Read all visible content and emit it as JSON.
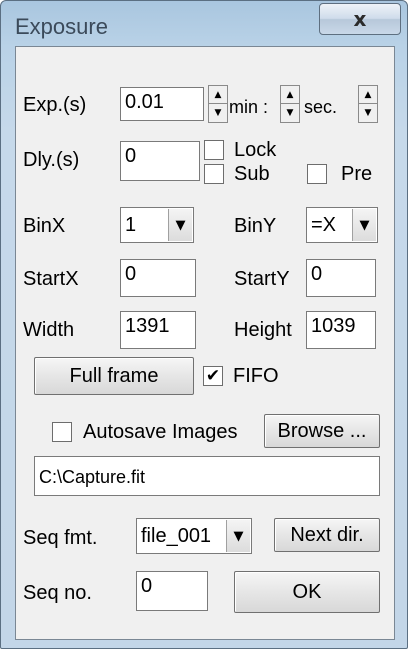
{
  "window": {
    "title": "Exposure",
    "close_glyph": "x"
  },
  "exposure": {
    "label": "Exp.(s)",
    "value": "0.01",
    "min_label": "min :",
    "sec_label": "sec."
  },
  "delay": {
    "label": "Dly.(s)",
    "value": "0"
  },
  "lock": {
    "label": "Lock",
    "checked": false
  },
  "sub": {
    "label": "Sub",
    "checked": false
  },
  "pre": {
    "label": "Pre",
    "checked": false
  },
  "binx": {
    "label": "BinX",
    "value": "1"
  },
  "biny": {
    "label": "BinY",
    "value": "=X"
  },
  "startx": {
    "label": "StartX",
    "value": "0"
  },
  "starty": {
    "label": "StartY",
    "value": "0"
  },
  "width": {
    "label": "Width",
    "value": "1391"
  },
  "height": {
    "label": "Height",
    "value": "1039"
  },
  "full_frame": {
    "label": "Full frame"
  },
  "fifo": {
    "label": "FIFO",
    "checked": true,
    "check_glyph": "✔"
  },
  "autosave": {
    "label": "Autosave Images",
    "checked": false
  },
  "browse": {
    "label": "Browse ..."
  },
  "path": {
    "value": "C:\\Capture.fit"
  },
  "seq_fmt": {
    "label": "Seq fmt.",
    "value": "file_001"
  },
  "next_dir": {
    "label": "Next dir."
  },
  "seq_no": {
    "label": "Seq no.",
    "value": "0"
  },
  "ok": {
    "label": "OK"
  },
  "icons": {
    "spin_up": "▲",
    "spin_down": "▼",
    "dropdown": "▼"
  }
}
